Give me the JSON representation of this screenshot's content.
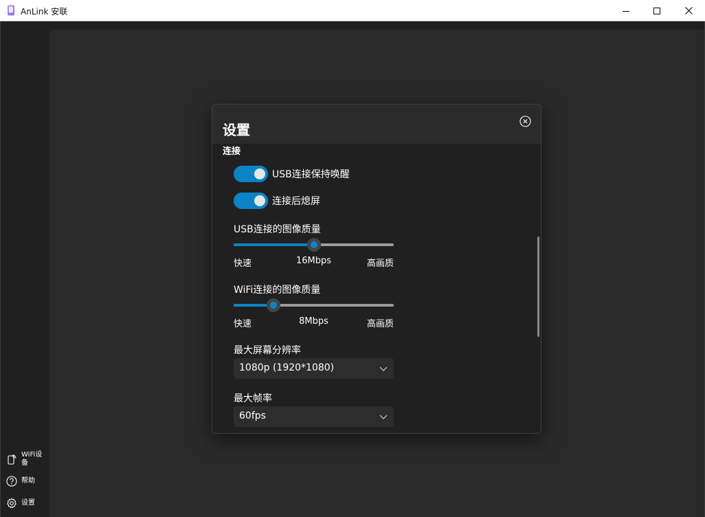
{
  "window": {
    "title": "AnLink 安联"
  },
  "sidebar": {
    "items": [
      {
        "label": "WiFi设备",
        "icon": "wifi-device-icon"
      },
      {
        "label": "帮助",
        "icon": "help-icon"
      },
      {
        "label": "设置",
        "icon": "gear-icon"
      }
    ]
  },
  "dialog": {
    "title": "设置",
    "section_title": "连接",
    "toggles": [
      {
        "label": "USB连接保持唤醒",
        "on": true
      },
      {
        "label": "连接后熄屏",
        "on": true
      }
    ],
    "usb_quality": {
      "label": "USB连接的图像质量",
      "min_label": "快速",
      "value_label": "16Mbps",
      "max_label": "高画质",
      "level": 0.5
    },
    "wifi_quality": {
      "label": "WiFi连接的图像质量",
      "min_label": "快速",
      "value_label": "8Mbps",
      "max_label": "高画质",
      "level": 0.25
    },
    "resolution": {
      "label": "最大屏幕分辨率",
      "value": "1080p (1920*1080)"
    },
    "frame_rate": {
      "label": "最大帧率",
      "value": "60fps"
    }
  },
  "colors": {
    "accent": "#0a84c6",
    "background": "#202020",
    "content": "#2a2a2a"
  }
}
